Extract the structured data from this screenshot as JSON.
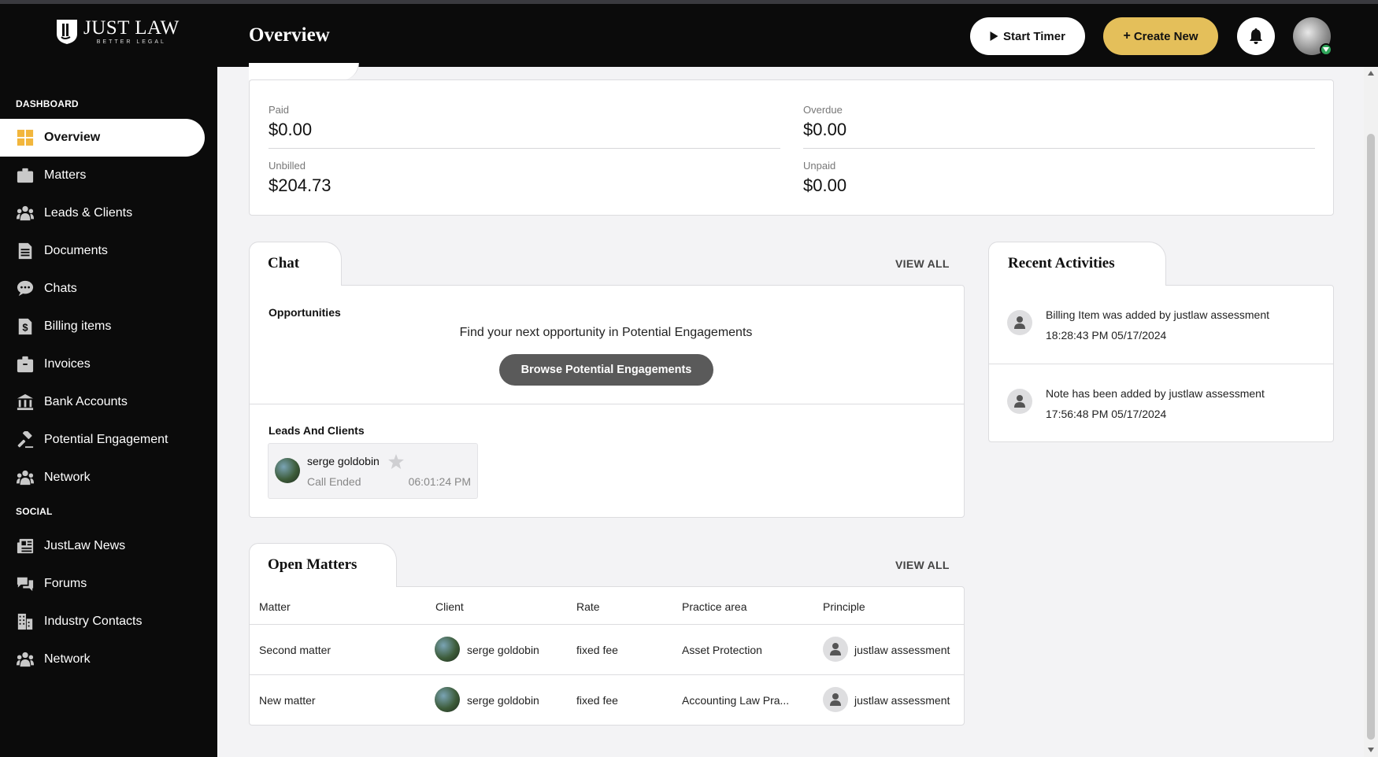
{
  "brand": {
    "name": "JUST LAW",
    "tagline": "BETTER LEGAL"
  },
  "sidebar": {
    "section_dashboard": "DASHBOARD",
    "section_social": "SOCIAL",
    "dashboard_items": [
      {
        "label": "Overview",
        "icon": "grid-icon",
        "active": true
      },
      {
        "label": "Matters",
        "icon": "briefcase-icon"
      },
      {
        "label": "Leads & Clients",
        "icon": "users-icon"
      },
      {
        "label": "Documents",
        "icon": "document-icon"
      },
      {
        "label": "Chats",
        "icon": "chat-bubble-icon"
      },
      {
        "label": "Billing items",
        "icon": "dollar-file-icon"
      },
      {
        "label": "Invoices",
        "icon": "invoice-box-icon"
      },
      {
        "label": "Bank Accounts",
        "icon": "bank-icon"
      },
      {
        "label": "Potential Engagement",
        "icon": "gavel-icon"
      },
      {
        "label": "Network",
        "icon": "users-icon"
      }
    ],
    "social_items": [
      {
        "label": "JustLaw News",
        "icon": "newspaper-icon"
      },
      {
        "label": "Forums",
        "icon": "forum-icon"
      },
      {
        "label": "Industry Contacts",
        "icon": "building-icon"
      },
      {
        "label": "Network",
        "icon": "users-icon"
      }
    ]
  },
  "header": {
    "title": "Overview",
    "start_timer": "Start Timer",
    "create_new": "Create New"
  },
  "billing": {
    "paid_label": "Paid",
    "paid_value": "$0.00",
    "overdue_label": "Overdue",
    "overdue_value": "$0.00",
    "unbilled_label": "Unbilled",
    "unbilled_value": "$204.73",
    "unpaid_label": "Unpaid",
    "unpaid_value": "$0.00"
  },
  "chat": {
    "title": "Chat",
    "view_all": "VIEW ALL",
    "opportunities_title": "Opportunities",
    "opportunities_text": "Find your next opportunity in Potential Engagements",
    "browse_button": "Browse Potential Engagements",
    "leads_title": "Leads And Clients",
    "lead": {
      "name": "serge goldobin",
      "status": "Call Ended",
      "time": "06:01:24 PM"
    }
  },
  "activities": {
    "title": "Recent Activities",
    "items": [
      {
        "text": "Billing Item was added by justlaw assessment",
        "time": "18:28:43 PM 05/17/2024"
      },
      {
        "text": "Note has been added by justlaw assessment",
        "time": "17:56:48 PM 05/17/2024"
      }
    ]
  },
  "matters": {
    "title": "Open Matters",
    "view_all": "VIEW ALL",
    "columns": [
      "Matter",
      "Client",
      "Rate",
      "Practice area",
      "Principle"
    ],
    "rows": [
      {
        "matter": "Second matter",
        "client": "serge goldobin",
        "rate": "fixed fee",
        "practice": "Asset Protection",
        "principle": "justlaw assessment"
      },
      {
        "matter": "New matter",
        "client": "serge goldobin",
        "rate": "fixed fee",
        "practice": "Accounting Law Pra...",
        "principle": "justlaw assessment"
      }
    ]
  },
  "colors": {
    "accent": "#e4bf5a",
    "sidebar_bg": "#0b0b0b",
    "active_icon": "#f2b63c"
  }
}
